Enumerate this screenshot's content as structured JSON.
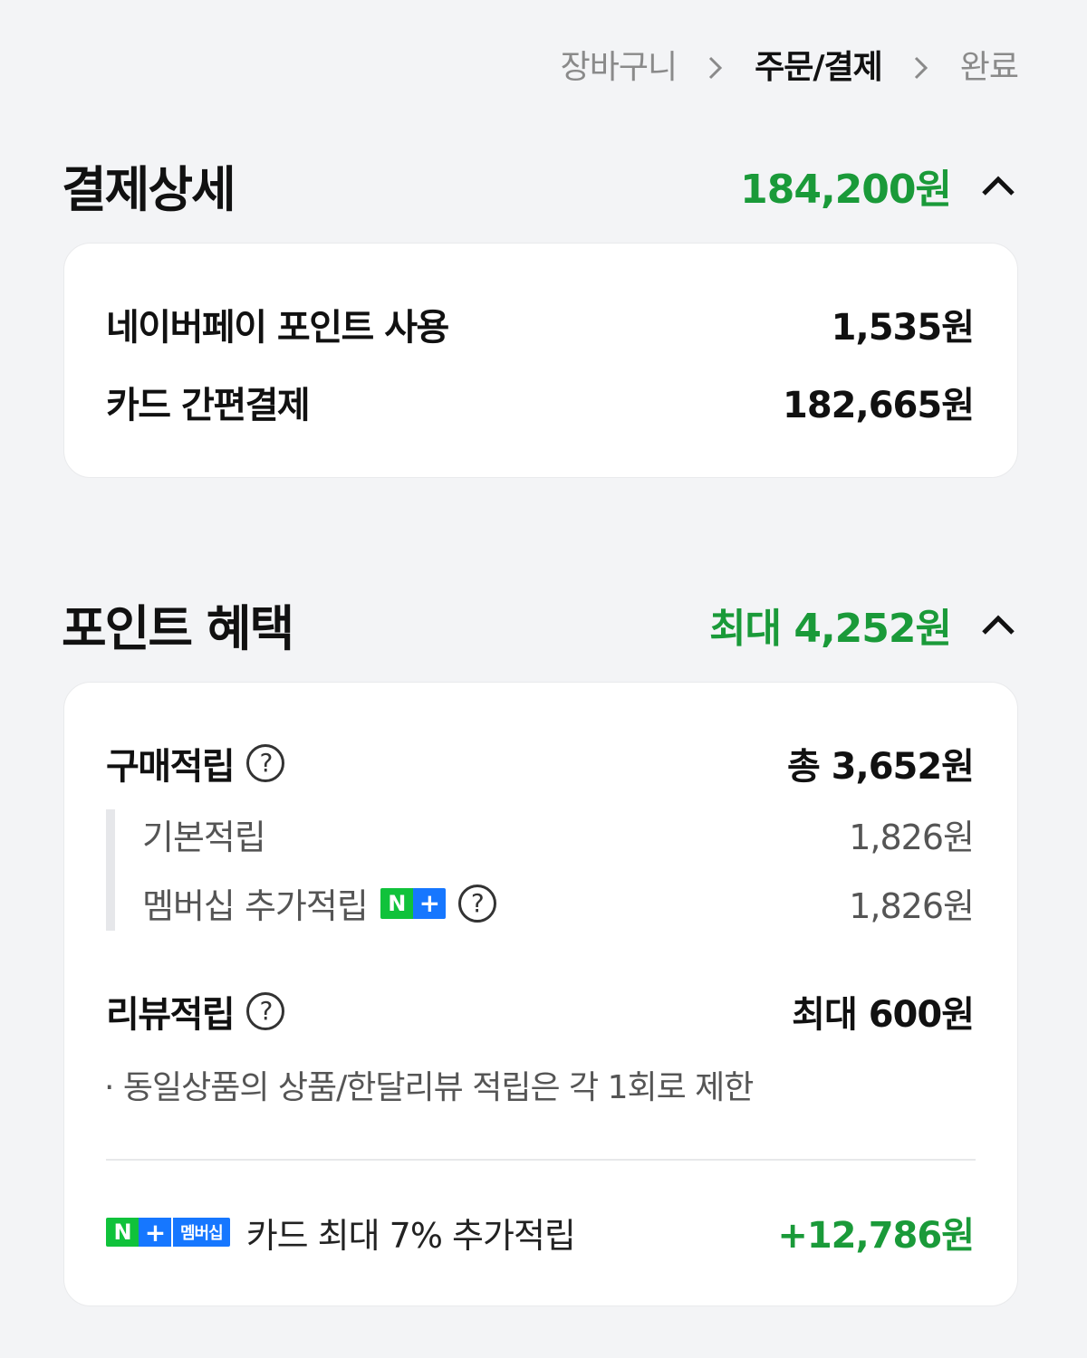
{
  "breadcrumb": {
    "steps": [
      "장바구니",
      "주문/결제",
      "완료"
    ],
    "active_index": 1
  },
  "payment": {
    "title": "결제상세",
    "total": "184,200원",
    "items": [
      {
        "label": "네이버페이 포인트 사용",
        "value": "1,535원"
      },
      {
        "label": "카드 간편결제",
        "value": "182,665원"
      }
    ]
  },
  "points": {
    "title": "포인트 혜택",
    "total": "최대 4,252원",
    "purchase": {
      "label": "구매적립",
      "value": "총 3,652원",
      "sub": [
        {
          "label": "기본적립",
          "value": "1,826원"
        },
        {
          "label": "멤버십 추가적립",
          "value": "1,826원"
        }
      ]
    },
    "review": {
      "label": "리뷰적립",
      "value": "최대 600원",
      "note": "· 동일상품의 상품/한달리뷰 적립은 각 1회로 제한"
    },
    "promo": {
      "badge_n": "N",
      "badge_plus": "+",
      "badge_text": "멤버십",
      "label": "카드 최대 7% 추가적립",
      "value": "+12,786원"
    }
  },
  "colors": {
    "accent_green": "#1a9a39",
    "naver_green": "#10c23b",
    "plus_blue": "#1677ff",
    "background": "#f3f4f6"
  },
  "icons": {
    "breadcrumb_separator": "chevron-right-icon",
    "collapse": "chevron-up-icon",
    "help": "question-circle-icon"
  }
}
